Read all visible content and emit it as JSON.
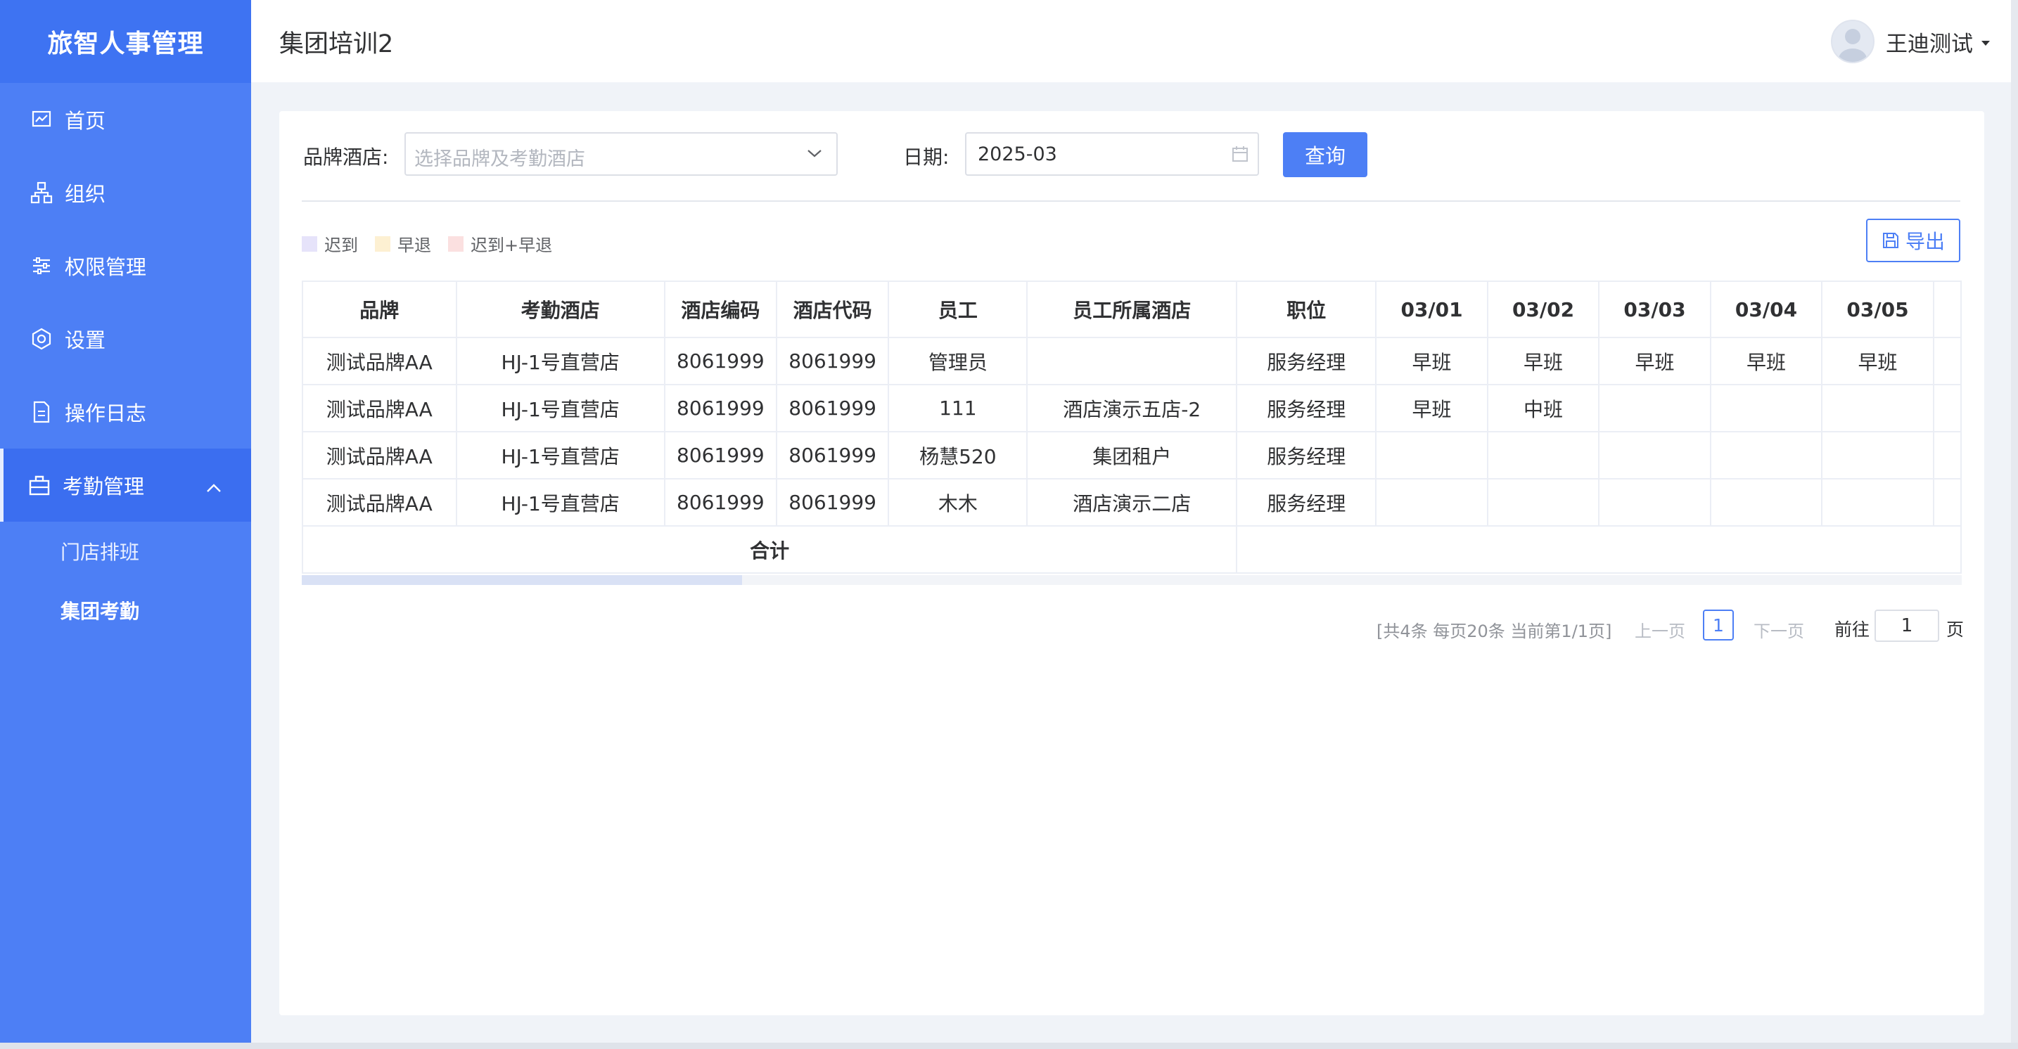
{
  "app": {
    "name": "旅智人事管理"
  },
  "sidebar": {
    "items": [
      {
        "label": "首页",
        "icon": "chart-line-icon"
      },
      {
        "label": "组织",
        "icon": "org-tree-icon"
      },
      {
        "label": "权限管理",
        "icon": "sliders-icon"
      },
      {
        "label": "设置",
        "icon": "gear-icon"
      },
      {
        "label": "操作日志",
        "icon": "document-icon"
      },
      {
        "label": "考勤管理",
        "icon": "briefcase-icon",
        "expanded": true,
        "active": true
      }
    ],
    "sub_items": [
      {
        "label": "门店排班"
      },
      {
        "label": "集团考勤",
        "active": true
      }
    ]
  },
  "header": {
    "title": "集团培训2",
    "user": "王迪测试"
  },
  "filters": {
    "brand_label": "品牌酒店:",
    "brand_placeholder": "选择品牌及考勤酒店",
    "date_label": "日期:",
    "date_value": "2025-03",
    "query_button": "查询"
  },
  "legend": [
    {
      "label": "迟到",
      "color": "#e6e3fa"
    },
    {
      "label": "早退",
      "color": "#fdf0d2"
    },
    {
      "label": "迟到+早退",
      "color": "#fbe0e0"
    }
  ],
  "export_button": "导出",
  "table": {
    "columns": [
      "品牌",
      "考勤酒店",
      "酒店编码",
      "酒店代码",
      "员工",
      "员工所属酒店",
      "职位",
      "03/01",
      "03/02",
      "03/03",
      "03/04",
      "03/05"
    ],
    "rows": [
      [
        "测试品牌AA",
        "HJ-1号直营店",
        "8061999",
        "8061999",
        "管理员",
        "",
        "服务经理",
        "早班",
        "早班",
        "早班",
        "早班",
        "早班"
      ],
      [
        "测试品牌AA",
        "HJ-1号直营店",
        "8061999",
        "8061999",
        "111",
        "酒店演示五店-2",
        "服务经理",
        "早班",
        "中班",
        "",
        "",
        ""
      ],
      [
        "测试品牌AA",
        "HJ-1号直营店",
        "8061999",
        "8061999",
        "杨慧520",
        "集团租户",
        "服务经理",
        "",
        "",
        "",
        "",
        ""
      ],
      [
        "测试品牌AA",
        "HJ-1号直营店",
        "8061999",
        "8061999",
        "木木",
        "酒店演示二店",
        "服务经理",
        "",
        "",
        "",
        "",
        ""
      ]
    ],
    "total_label": "合计"
  },
  "pagination": {
    "summary": "[共4条 每页20条 当前第1/1页]",
    "prev": "上一页",
    "current": "1",
    "next": "下一页",
    "goto_label": "前往",
    "goto_value": "1",
    "unit": "页"
  }
}
